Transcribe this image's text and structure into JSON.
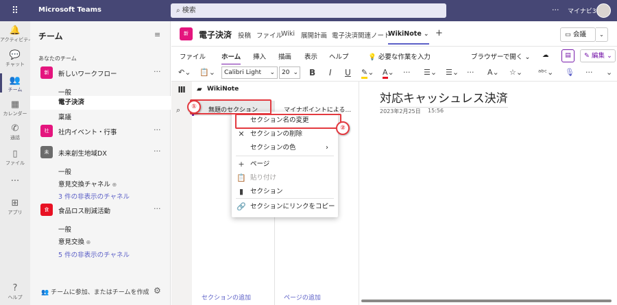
{
  "topbar": {
    "app_name": "Microsoft Teams",
    "search_placeholder": "検索",
    "more": "···",
    "user_name": "マイナビ365"
  },
  "rail": [
    {
      "label": "アクティビティ",
      "icon": "bell-icon",
      "glyph": "🔔"
    },
    {
      "label": "チャット",
      "icon": "chat-icon",
      "glyph": "💬"
    },
    {
      "label": "チーム",
      "icon": "teams-icon",
      "glyph": "👥",
      "active": true
    },
    {
      "label": "カレンダー",
      "icon": "calendar-icon",
      "glyph": "▦"
    },
    {
      "label": "通話",
      "icon": "phone-icon",
      "glyph": "✆"
    },
    {
      "label": "ファイル",
      "icon": "file-icon",
      "glyph": "▯"
    },
    {
      "label": "···",
      "icon": "more-icon",
      "glyph": ""
    },
    {
      "label": "アプリ",
      "icon": "apps-icon",
      "glyph": "⊞"
    },
    {
      "label": "ヘルプ",
      "icon": "help-icon",
      "glyph": "?"
    }
  ],
  "teams_panel": {
    "title": "チーム",
    "section_label": "あなたのチーム",
    "teams": [
      {
        "badge": "新",
        "color": "#e4157e",
        "name": "新しいワークフロー",
        "channels": [
          "一般",
          "電子決済",
          "稟議"
        ],
        "selected_channel": 1
      },
      {
        "badge": "社",
        "color": "#e4157e",
        "name": "社内イベント・行事",
        "channels": []
      },
      {
        "badge": "未",
        "color": "#6b6b6b",
        "name": "未来創生地域DX",
        "channels": [
          "一般",
          "意見交換チャネル"
        ],
        "hidden": "3 件の非表示のチャネル"
      },
      {
        "badge": "食",
        "color": "#e81123",
        "name": "食品ロス削減活動",
        "channels": [
          "一般",
          "意見交換"
        ],
        "hidden": "5 件の非表示のチャネル"
      }
    ],
    "join_label": "チームに参加、またはチームを作成"
  },
  "channel_header": {
    "badge": "新",
    "name": "電子決済",
    "tabs": [
      "投稿",
      "ファイル",
      "Wiki",
      "展開計画",
      "電子決済関連ノート",
      "WikiNote"
    ],
    "active_tab": "WikiNote",
    "meet_label": "会議"
  },
  "ribbon_menu": {
    "items": [
      "ファイル",
      "ホーム",
      "挿入",
      "描画",
      "表示",
      "ヘルプ"
    ],
    "active": "ホーム",
    "tell_me": "必要な作業を入力",
    "browser_open": "ブラウザーで開く",
    "edit_label": "編集"
  },
  "toolbar": {
    "font_name": "Calibri Light",
    "font_size": "20",
    "bold": "B",
    "italic": "I",
    "underline": "U"
  },
  "notebook": {
    "name": "WikiNote",
    "section_name": "無題のセクション",
    "page_name": "マイナポイントによる...",
    "add_section": "セクションの追加",
    "add_page": "ページの追加"
  },
  "page": {
    "title": "対応キャッシュレス決済",
    "date": "2023年2月25日",
    "time": "15:56"
  },
  "context_menu": {
    "items": [
      {
        "label": "セクション名の変更",
        "icon": "rename-icon",
        "glyph": ""
      },
      {
        "label": "セクションの削除",
        "icon": "delete-icon",
        "glyph": "✕"
      },
      {
        "label": "セクションの色",
        "icon": "color-icon",
        "glyph": "",
        "submenu": true
      },
      {
        "label": "ページ",
        "icon": "plus-icon",
        "glyph": "+"
      },
      {
        "label": "貼り付け",
        "icon": "paste-icon",
        "glyph": "📋",
        "disabled": true
      },
      {
        "label": "セクション",
        "icon": "section-icon",
        "glyph": "▮"
      },
      {
        "label": "セクションにリンクをコピー",
        "icon": "link-icon",
        "glyph": "🔗"
      }
    ]
  },
  "annotations": {
    "step1": "①",
    "step2": "②",
    "color": "#e3393f"
  }
}
